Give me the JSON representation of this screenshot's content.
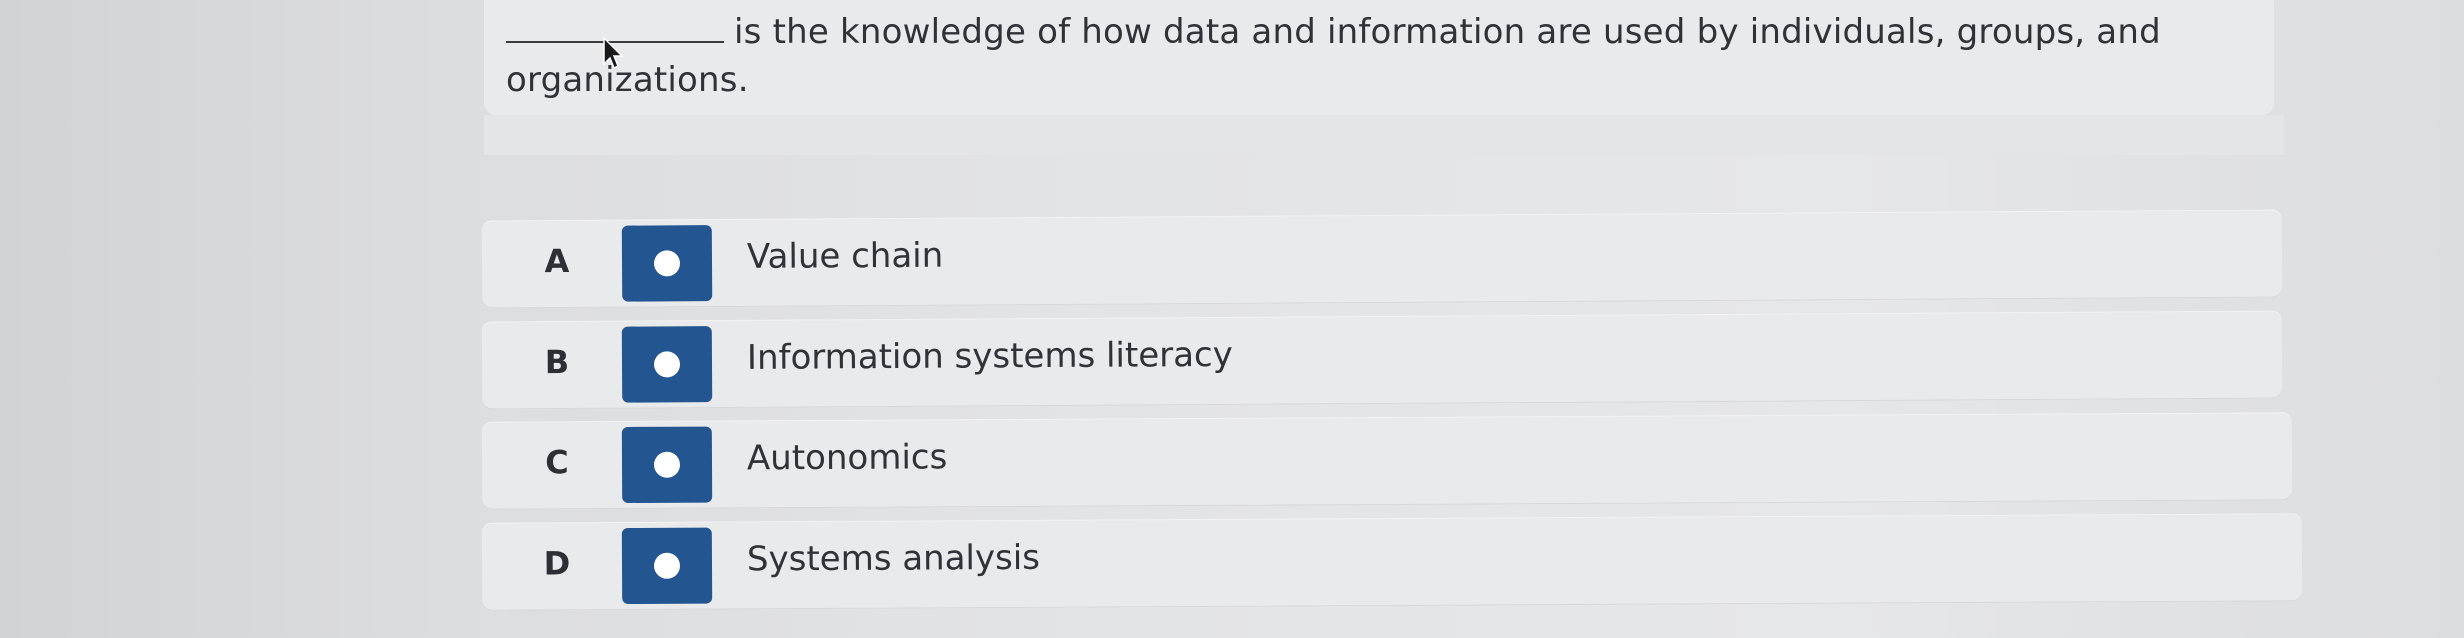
{
  "question": {
    "text": "is the knowledge of how data and information are used by individuals, groups, and organizations."
  },
  "options": [
    {
      "letter": "A",
      "label": "Value chain"
    },
    {
      "letter": "B",
      "label": "Information systems literacy"
    },
    {
      "letter": "C",
      "label": "Autonomics"
    },
    {
      "letter": "D",
      "label": "Systems analysis"
    }
  ],
  "colors": {
    "radio_fill": "#235590",
    "radio_dot": "#ffffff",
    "card": "#e9eaec"
  },
  "icons": {
    "cursor": "mouse-pointer-icon",
    "radio": "radio-button-icon"
  }
}
